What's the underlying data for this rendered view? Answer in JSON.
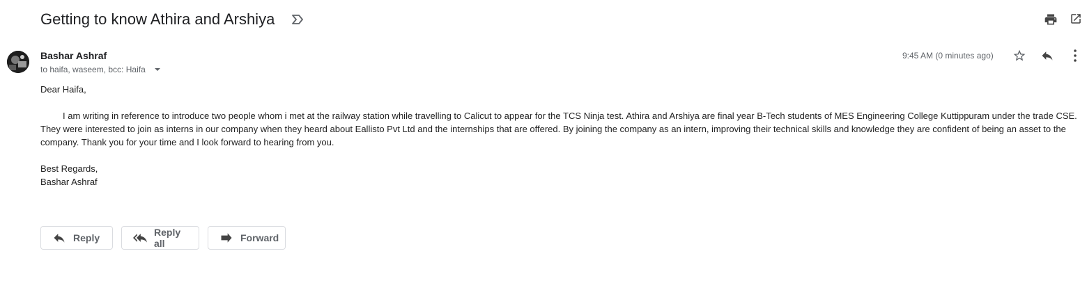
{
  "message": {
    "subject": "Getting to know Athira and Arshiya",
    "sender": {
      "name": "Bashar Ashraf"
    },
    "recipients_line": "to haifa, waseem, bcc: Haifa",
    "timestamp": "9:45 AM (0 minutes ago)",
    "body": {
      "greeting": "Dear Haifa,",
      "paragraph": "I am writing in reference to introduce two people whom i met at the railway station while travelling to Calicut to appear for the TCS Ninja test. Athira and Arshiya are final year B-Tech students of MES Engineering College Kuttippuram under the trade CSE. They were interested to join as interns in our company when they heard about Eallisto Pvt Ltd and the internships that are offered. By joining the company as an intern, improving their technical skills and knowledge they are confident of being an asset to the company. Thank you for your time and I look forward to hearing from you.",
      "closing": "Best Regards,",
      "signature": "Bashar Ashraf"
    }
  },
  "actions": {
    "reply_label": "Reply",
    "reply_all_label": "Reply all",
    "forward_label": "Forward"
  },
  "icons": {
    "label": "label-icon",
    "print": "print-icon",
    "popout": "open-in-new-window-icon",
    "star": "star-icon",
    "reply": "reply-icon",
    "more": "more-vertical-icon",
    "dropdown": "caret-down-icon",
    "reply_all": "reply-all-icon",
    "forward": "forward-icon"
  },
  "colors": {
    "text": "#202124",
    "muted": "#5f6368",
    "border": "#dadce0"
  }
}
